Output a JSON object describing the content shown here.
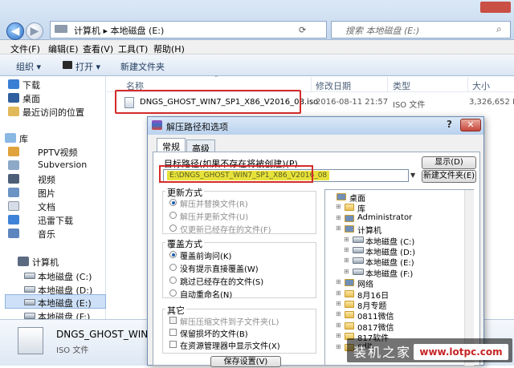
{
  "window": {
    "breadcrumb": [
      "计算机",
      "本地磁盘 (E:)"
    ],
    "search_placeholder": "搜索 本地磁盘 (E:)"
  },
  "menu": [
    "文件(F)",
    "编辑(E)",
    "查看(V)",
    "工具(T)",
    "帮助(H)"
  ],
  "toolbar": {
    "organize": "组织 ▾",
    "open": "打开 ▾",
    "new_folder": "新建文件夹"
  },
  "nav": {
    "top": [
      "下载",
      "桌面",
      "最近访问的位置"
    ],
    "library_label": "库",
    "library": [
      "PPTV视频",
      "Subversion",
      "视频",
      "图片",
      "文档",
      "迅雷下载",
      "音乐"
    ],
    "computer_label": "计算机",
    "drives": [
      "本地磁盘 (C:)",
      "本地磁盘 (D:)",
      "本地磁盘 (E:)",
      "本地磁盘 (F:)"
    ]
  },
  "columns": [
    "名称",
    "修改日期",
    "类型",
    "大小"
  ],
  "file": {
    "name": "DNGS_GHOST_WIN7_SP1_X86_V2016_08.iso",
    "date": "2016-08-11 21:57",
    "type": "ISO 文件",
    "size": "3,326,652 K"
  },
  "details": {
    "name": "DNGS_GHOST_WIN7_SP",
    "type": "ISO 文件"
  },
  "dialog": {
    "title": "解压路径和选项",
    "help": "?",
    "close": "✕",
    "tabs": [
      "常规",
      "高级"
    ],
    "target_label": "目标路径(如果不存在将被创建)(P)",
    "target_value": "E:\\DNGS_GHOST_WIN7_SP1_X86_V2016_08",
    "btn_show": "显示(D)",
    "btn_new_folder": "新建文件夹(E)",
    "update_title": "更新方式",
    "update_opts": [
      "解压并替换文件(R)",
      "解压并更新文件(U)",
      "仅更新已经存在的文件(F)"
    ],
    "overwrite_title": "覆盖方式",
    "overwrite_opts": [
      "覆盖前询问(K)",
      "没有提示直接覆盖(W)",
      "跳过已经存在的文件(S)",
      "自动重命名(N)"
    ],
    "misc_title": "其它",
    "misc_opts": [
      "解压压缩文件到子文件夹(L)",
      "保留损坏的文件(B)",
      "在资源管理器中显示文件(X)"
    ],
    "save_btn": "保存设置(V)"
  },
  "tree": [
    {
      "label": "桌面",
      "kind": "desktop",
      "indent": 0
    },
    {
      "label": "库",
      "kind": "folder",
      "indent": 1
    },
    {
      "label": "Administrator",
      "kind": "user",
      "indent": 1
    },
    {
      "label": "计算机",
      "kind": "computer",
      "indent": 1
    },
    {
      "label": "本地磁盘 (C:)",
      "kind": "drive",
      "indent": 2
    },
    {
      "label": "本地磁盘 (D:)",
      "kind": "drive",
      "indent": 2
    },
    {
      "label": "本地磁盘 (E:)",
      "kind": "drive",
      "indent": 2
    },
    {
      "label": "本地磁盘 (F:)",
      "kind": "drive",
      "indent": 2
    },
    {
      "label": "网络",
      "kind": "network",
      "indent": 1
    },
    {
      "label": "8月16日",
      "kind": "folder",
      "indent": 1
    },
    {
      "label": "8月专题",
      "kind": "folder",
      "indent": 1
    },
    {
      "label": "0811微信",
      "kind": "folder",
      "indent": 1
    },
    {
      "label": "0817微信",
      "kind": "folder",
      "indent": 1
    },
    {
      "label": "817软件",
      "kind": "folder",
      "indent": 1
    },
    {
      "label": "cdlt",
      "kind": "folder",
      "indent": 1
    }
  ],
  "watermark": {
    "brand": "装机之家",
    "url": "www.lotpc.com"
  }
}
